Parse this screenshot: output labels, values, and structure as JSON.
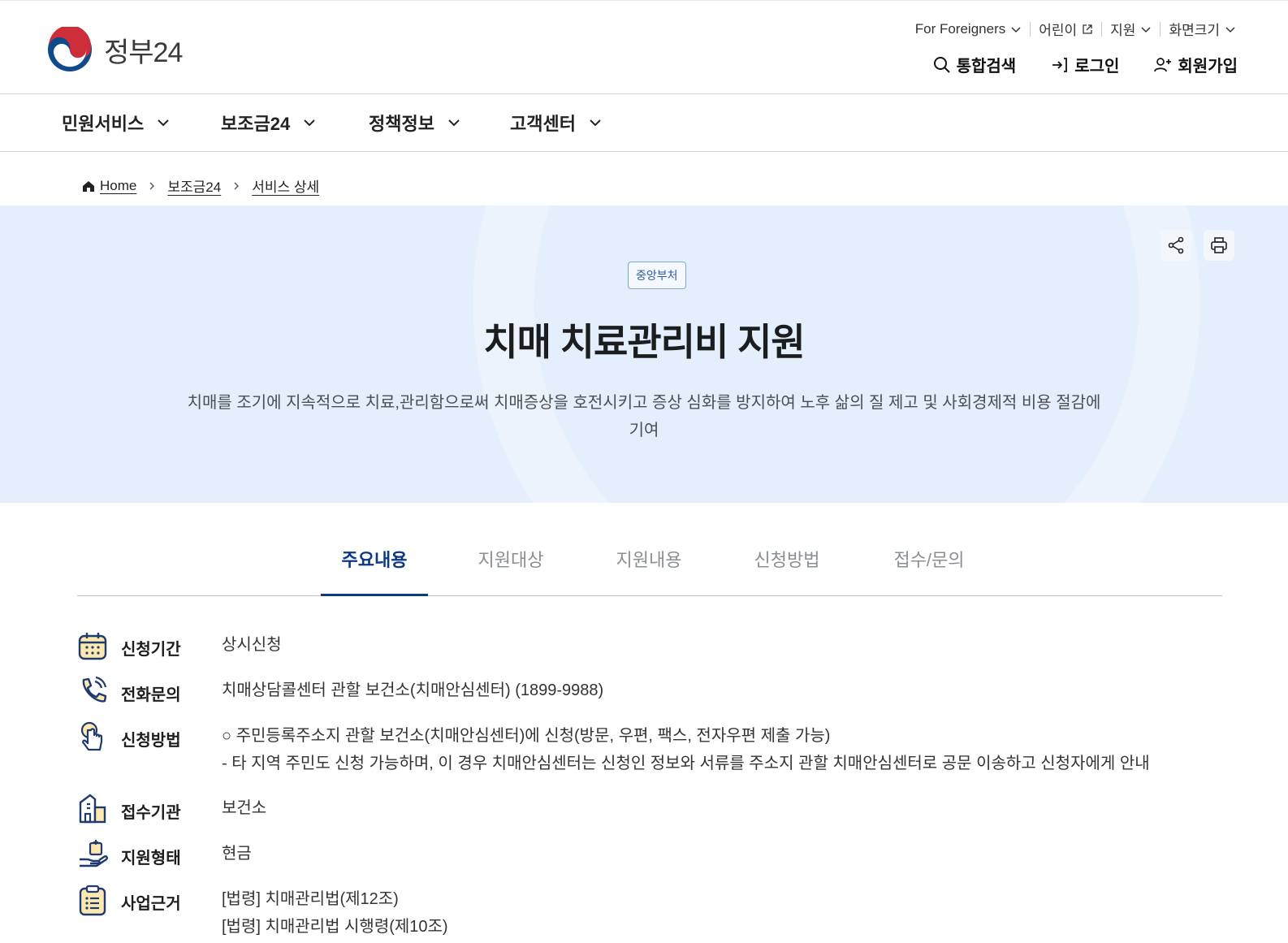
{
  "header": {
    "logo_text": "정부24",
    "util": {
      "foreigners": "For Foreigners",
      "kids": "어린이",
      "support": "지원",
      "screen_size": "화면크기"
    },
    "actions": {
      "search": "통합검색",
      "login": "로그인",
      "signup": "회원가입"
    }
  },
  "gnb": {
    "items": [
      "민원서비스",
      "보조금24",
      "정책정보",
      "고객센터"
    ]
  },
  "breadcrumb": {
    "home": "Home",
    "level1": "보조금24",
    "level2": "서비스 상세"
  },
  "hero": {
    "badge": "중앙부처",
    "title": "치매 치료관리비 지원",
    "desc_line1": "치매를 조기에 지속적으로 치료,관리함으로써 치매증상을 호전시키고 증상 심화를 방지하여 노후 삶의 질 제고 및 사회경제적 비용 절감에",
    "desc_line2": "기여"
  },
  "tabs": [
    "주요내용",
    "지원대상",
    "지원내용",
    "신청방법",
    "접수/문의"
  ],
  "info": {
    "period": {
      "label": "신청기간",
      "value": "상시신청"
    },
    "phone": {
      "label": "전화문의",
      "value": "치매상담콜센터 관할 보건소(치매안심센터) (1899-9988)"
    },
    "method": {
      "label": "신청방법",
      "value1": "○ 주민등록주소지 관할 보건소(치매안심센터)에 신청(방문, 우편, 팩스, 전자우편 제출 가능)",
      "value2": "- 타 지역 주민도 신청 가능하며, 이 경우 치매안심센터는 신청인 정보와 서류를 주소지 관할 치매안심센터로 공문 이송하고 신청자에게 안내"
    },
    "agency": {
      "label": "접수기관",
      "value": "보건소"
    },
    "type": {
      "label": "지원형태",
      "value": "현금"
    },
    "basis": {
      "label": "사업근거",
      "value1": "[법령] 치매관리법(제12조)",
      "value2": "[법령] 치매관리법 시행령(제10조)"
    }
  },
  "colors": {
    "hero_bg": "#e4eefd",
    "active_tab": "#0b3a82",
    "logo_red": "#cd2e3a",
    "logo_blue": "#0f4a8a"
  }
}
